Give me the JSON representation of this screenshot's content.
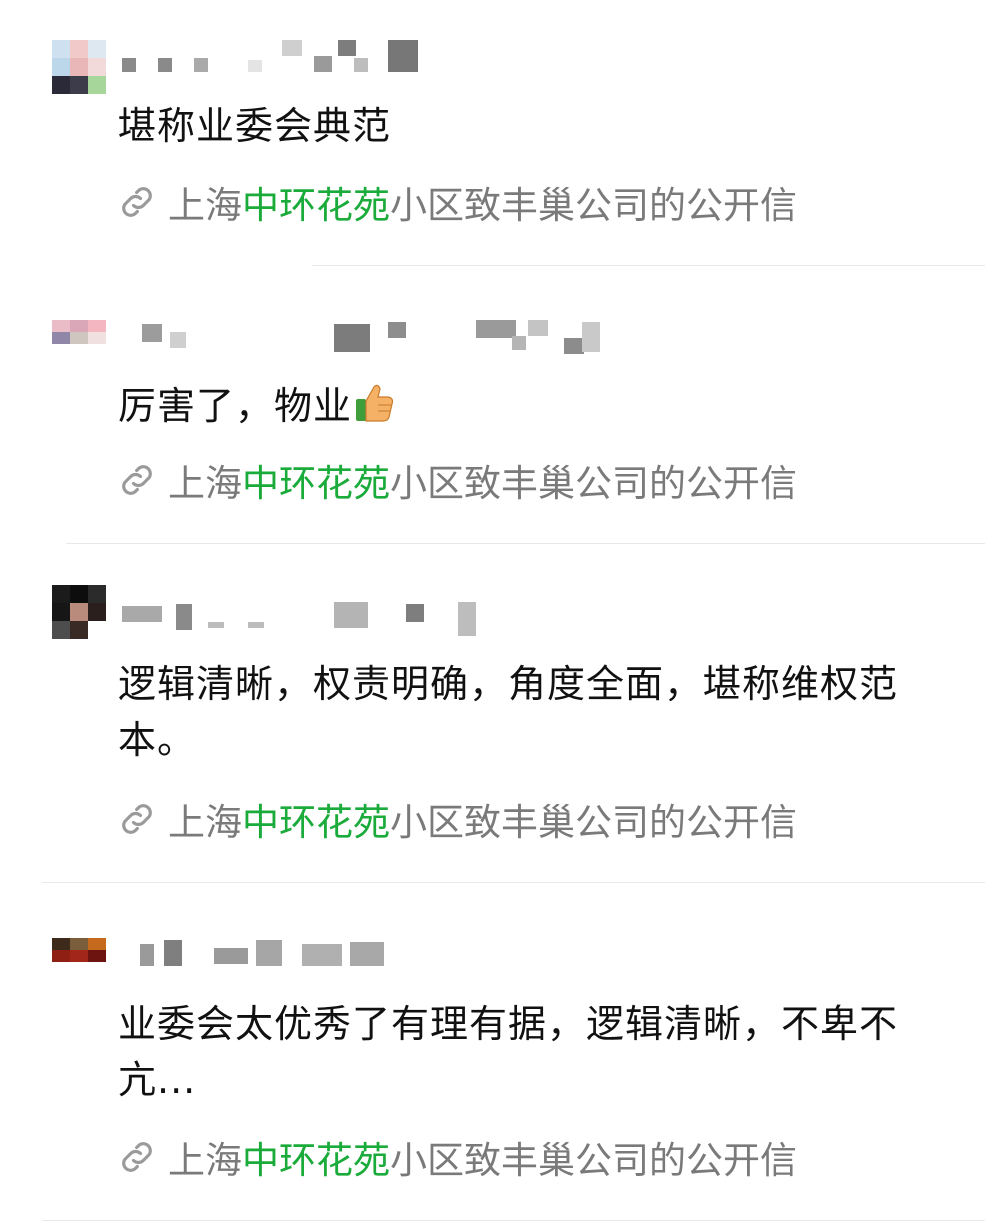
{
  "comments": [
    {
      "text": "堪称业委会典范",
      "link": {
        "pre": "上海",
        "highlight": "中环花苑",
        "post": "小区致丰巢公司的公开信"
      }
    },
    {
      "text": "厉害了，物业",
      "link": {
        "pre": "上海",
        "highlight": "中环花苑",
        "post": "小区致丰巢公司的公开信"
      }
    },
    {
      "text": "逻辑清晰，权责明确，角度全面，堪称维权范本。",
      "link": {
        "pre": "上海",
        "highlight": "中环花苑",
        "post": "小区致丰巢公司的公开信"
      }
    },
    {
      "text": "业委会太优秀了有理有据，逻辑清晰，不卑不亢...",
      "link": {
        "pre": "上海",
        "highlight": "中环花苑",
        "post": "小区致丰巢公司的公开信"
      }
    }
  ],
  "icons": {
    "link": "link-icon",
    "emoji": "thumbs-up-icon"
  },
  "colors": {
    "highlight": "#1aab3a",
    "link_text": "#7a7a7a",
    "body_text": "#111111"
  }
}
